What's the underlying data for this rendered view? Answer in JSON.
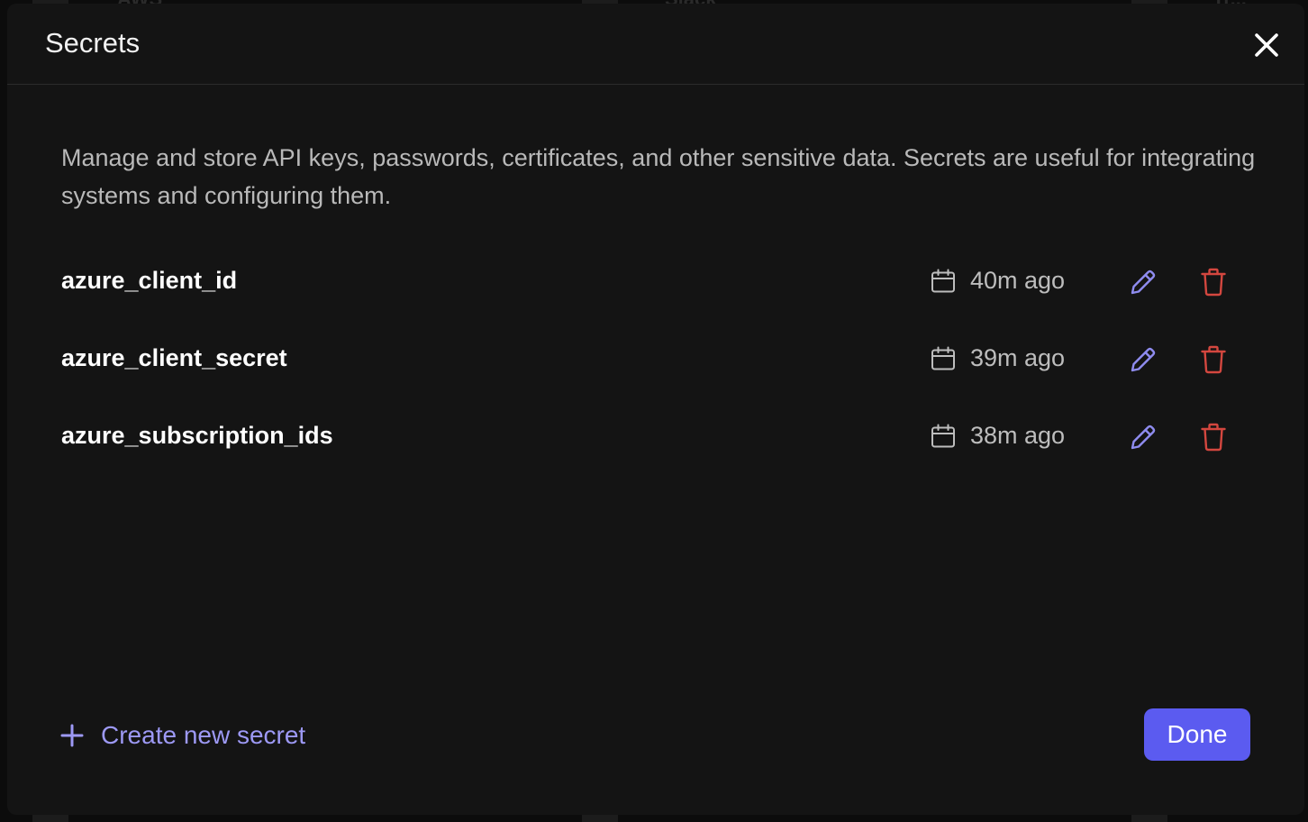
{
  "background": {
    "cards": [
      "AWS",
      "Slack",
      "Tr..."
    ]
  },
  "modal": {
    "title": "Secrets",
    "description": "Manage and store API keys, passwords, certificates, and other sensitive data. Secrets are useful for integrating systems and configuring them.",
    "secrets": [
      {
        "name": "azure_client_id",
        "updated": "40m ago"
      },
      {
        "name": "azure_client_secret",
        "updated": "39m ago"
      },
      {
        "name": "azure_subscription_ids",
        "updated": "38m ago"
      }
    ],
    "create_label": "Create new secret",
    "done_label": "Done"
  },
  "icons": {
    "close": "close-icon",
    "calendar": "calendar-icon",
    "edit": "pencil-icon",
    "delete": "trash-icon",
    "add": "plus-icon"
  },
  "colors": {
    "accent": "#5b5bf0",
    "link": "#9d99f5",
    "edit_icon": "#8f8cf0",
    "delete_icon": "#d4473f",
    "modal_bg": "#141414"
  }
}
